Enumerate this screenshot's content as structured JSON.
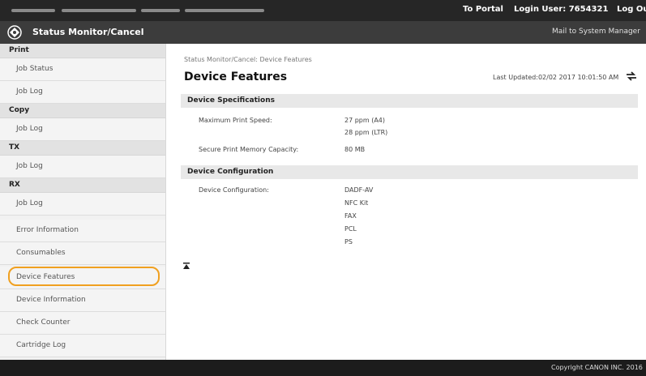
{
  "topbar": {
    "portal_label": "To Portal",
    "login_user": "Login User:  7654321",
    "logout_label": "Log Out"
  },
  "header": {
    "title": "Status Monitor/Cancel",
    "mail_link": "Mail to System Manager"
  },
  "sidebar": {
    "print_heading": "Print",
    "print_job_status": "Job Status",
    "print_job_log": "Job Log",
    "copy_heading": "Copy",
    "copy_job_log": "Job Log",
    "tx_heading": "TX",
    "tx_job_log": "Job Log",
    "rx_heading": "RX",
    "rx_job_log": "Job Log",
    "error_information": "Error Information",
    "consumables": "Consumables",
    "device_features": "Device Features",
    "device_information": "Device Information",
    "check_counter": "Check Counter",
    "cartridge_log": "Cartridge Log"
  },
  "main": {
    "breadcrumb": "Status Monitor/Cancel: Device Features",
    "title": "Device Features",
    "last_updated": "Last Updated:02/02 2017 10:01:50 AM",
    "spec_heading": "Device Specifications",
    "max_speed_label": "Maximum Print Speed:",
    "max_speed_a4": "27 ppm (A4)",
    "max_speed_ltr": "28 ppm (LTR)",
    "secure_memory_label": "Secure Print Memory Capacity:",
    "secure_memory_value": "80 MB",
    "config_heading": "Device Configuration",
    "config_label": "Device Configuration:",
    "config_items": [
      "DADF-AV",
      "NFC Kit",
      "FAX",
      "PCL",
      "PS"
    ]
  },
  "footer": {
    "copyright": "Copyright CANON INC. 2016"
  },
  "colors": {
    "highlight": "#f0a020",
    "topbar": "#262626",
    "titlebar": "#3c3c3c"
  }
}
